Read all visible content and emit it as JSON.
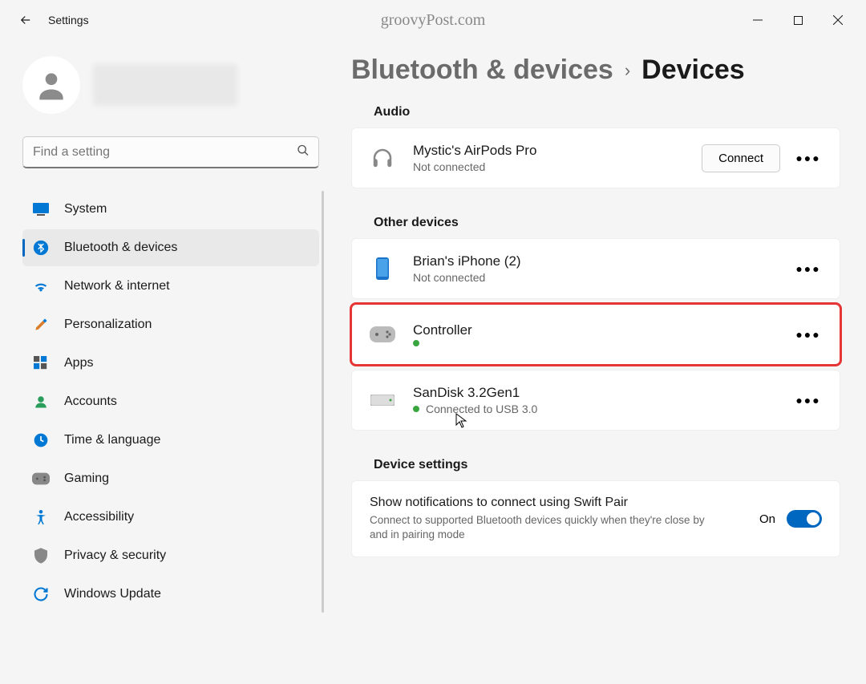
{
  "app_title": "Settings",
  "watermark": "groovyPost.com",
  "search": {
    "placeholder": "Find a setting"
  },
  "nav": {
    "items": [
      {
        "label": "System"
      },
      {
        "label": "Bluetooth & devices"
      },
      {
        "label": "Network & internet"
      },
      {
        "label": "Personalization"
      },
      {
        "label": "Apps"
      },
      {
        "label": "Accounts"
      },
      {
        "label": "Time & language"
      },
      {
        "label": "Gaming"
      },
      {
        "label": "Accessibility"
      },
      {
        "label": "Privacy & security"
      },
      {
        "label": "Windows Update"
      }
    ]
  },
  "breadcrumb": {
    "parent": "Bluetooth & devices",
    "current": "Devices"
  },
  "sections": {
    "audio": {
      "title": "Audio",
      "devices": [
        {
          "name": "Mystic's AirPods Pro",
          "status": "Not connected",
          "action": "Connect"
        }
      ]
    },
    "other": {
      "title": "Other devices",
      "devices": [
        {
          "name": "Brian's iPhone (2)",
          "status": "Not connected"
        },
        {
          "name": "Controller",
          "status": ""
        },
        {
          "name": "SanDisk 3.2Gen1",
          "status": "Connected to USB 3.0"
        }
      ]
    },
    "settings": {
      "title": "Device settings",
      "swift_pair": {
        "title": "Show notifications to connect using Swift Pair",
        "desc": "Connect to supported Bluetooth devices quickly when they're close by and in pairing mode",
        "state_label": "On"
      }
    }
  }
}
